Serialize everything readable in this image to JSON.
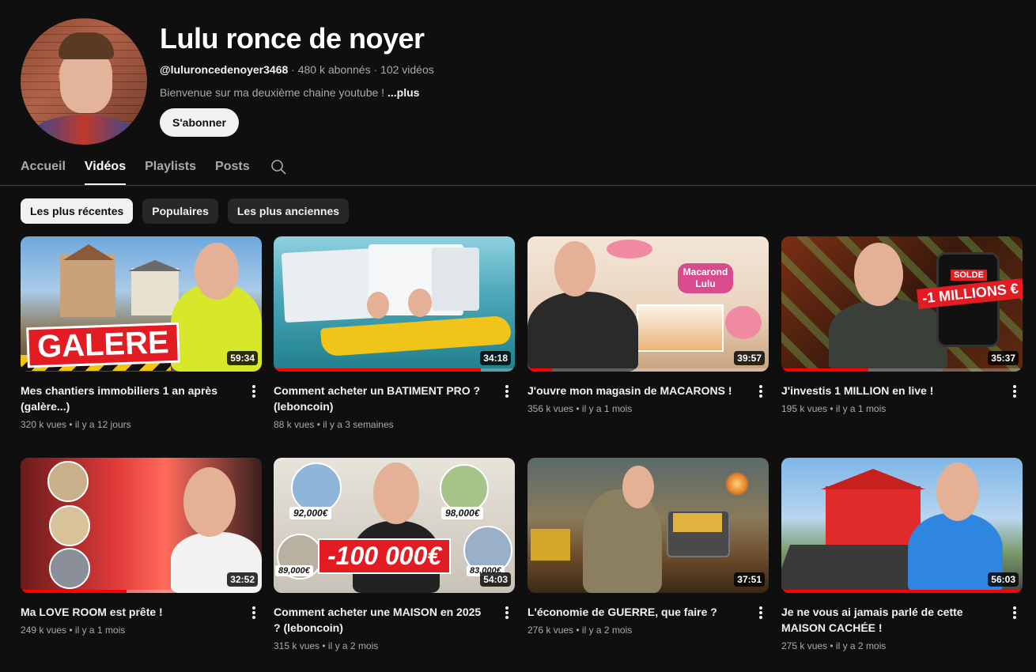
{
  "channel": {
    "name": "Lulu ronce de noyer",
    "handle": "@luluroncedenoyer3468",
    "subscribers": "480 k abonnés",
    "video_count": "102 vidéos",
    "separator": "·",
    "description": "Bienvenue sur ma deuxième chaine youtube !",
    "more_label": "...plus",
    "subscribe_label": "S'abonner"
  },
  "tabs": [
    {
      "label": "Accueil",
      "active": false
    },
    {
      "label": "Vidéos",
      "active": true
    },
    {
      "label": "Playlists",
      "active": false
    },
    {
      "label": "Posts",
      "active": false
    }
  ],
  "chips": [
    {
      "label": "Les plus récentes",
      "active": true
    },
    {
      "label": "Populaires",
      "active": false
    },
    {
      "label": "Les plus anciennes",
      "active": false
    }
  ],
  "videos": [
    {
      "title": "Mes chantiers immobiliers 1 an après (galère...)",
      "views": "320 k vues",
      "age": "il y a 12 jours",
      "duration": "59:34",
      "thumb_text": "GALERE",
      "progress": 0
    },
    {
      "title": "Comment acheter un BATIMENT PRO ? (leboncoin)",
      "views": "88 k vues",
      "age": "il y a 3 semaines",
      "duration": "34:18",
      "thumb_text": "",
      "progress": 0.86
    },
    {
      "title": "J'ouvre mon magasin de MACARONS !",
      "views": "356 k vues",
      "age": "il y a 1 mois",
      "duration": "39:57",
      "thumb_text": "Macarond Lulu",
      "progress": 0.1
    },
    {
      "title": "J'investis 1 MILLION en live !",
      "views": "195 k vues",
      "age": "il y a 1 mois",
      "duration": "35:37",
      "thumb_text": "-1 MILLIONS €",
      "thumb_subtext": "SOLDE",
      "progress": 0.36
    },
    {
      "title": "Ma LOVE ROOM est prête !",
      "views": "249 k vues",
      "age": "il y a 1 mois",
      "duration": "32:52",
      "thumb_text": "",
      "progress": 0.44
    },
    {
      "title": "Comment acheter une MAISON en 2025 ? (leboncoin)",
      "views": "315 k vues",
      "age": "il y a 2 mois",
      "duration": "54:03",
      "thumb_text": "-100 000€",
      "prices": [
        "92,000€",
        "98,000€",
        "89,000€",
        "83,000€"
      ],
      "progress": 0
    },
    {
      "title": "L'économie de GUERRE, que faire ?",
      "views": "276 k vues",
      "age": "il y a 2 mois",
      "duration": "37:51",
      "thumb_text": "",
      "progress": 0
    },
    {
      "title": "Je ne vous ai jamais parlé de cette MAISON CACHÉE !",
      "views": "275 k vues",
      "age": "il y a 2 mois",
      "duration": "56:03",
      "thumb_text": "",
      "progress": 1.0
    }
  ],
  "colors": {
    "background": "#0f0f0f",
    "progress": "#ff0000",
    "chip_active_bg": "#f1f1f1",
    "chip_bg": "#272727"
  }
}
